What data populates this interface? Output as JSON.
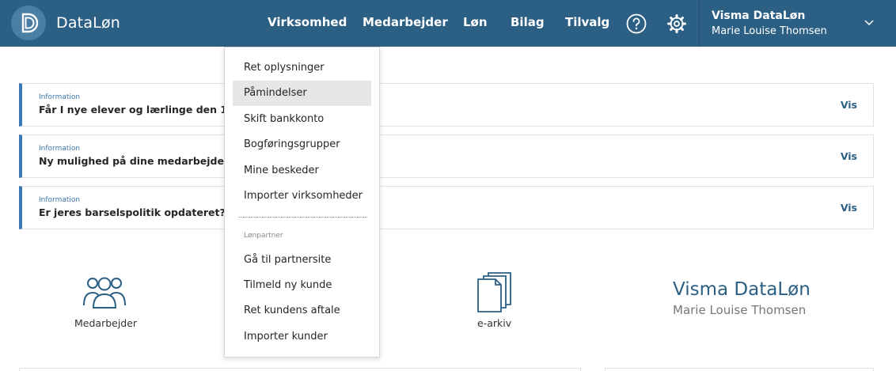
{
  "app": {
    "brand": "DataLøn"
  },
  "nav": {
    "items": [
      "Virksomhed",
      "Medarbejder",
      "Løn",
      "Bilag",
      "Tilvalg"
    ]
  },
  "user": {
    "company": "Visma DataLøn",
    "name": "Marie Louise Thomsen"
  },
  "notices": [
    {
      "tag": "Information",
      "text": "Får I nye elever og lærlinge den 1. janu",
      "link": "Vis"
    },
    {
      "tag": "Information",
      "text": "Ny mulighed på dine medarbejdere i D",
      "link": "Vis"
    },
    {
      "tag": "Information",
      "text": "Er jeres barselspolitik opdateret?",
      "link": "Vis"
    }
  ],
  "tiles": {
    "medarbejder": "Medarbejder",
    "earkiv": "e-arkiv"
  },
  "company_card": {
    "title": "Visma DataLøn",
    "subtitle": "Marie Louise Thomsen"
  },
  "dropdown": {
    "items": [
      "Ret oplysninger",
      "Påmindelser",
      "Skift bankkonto",
      "Bogføringsgrupper",
      "Mine beskeder",
      "Importer virksomheder"
    ],
    "active_index": 1,
    "section_label": "Lønpartner",
    "partner_items": [
      "Gå til partnersite",
      "Tilmeld ny kunde",
      "Ret kundens aftale",
      "Importer kunder"
    ]
  },
  "colors": {
    "header": "#2c5f84",
    "accent": "#3878b4"
  }
}
